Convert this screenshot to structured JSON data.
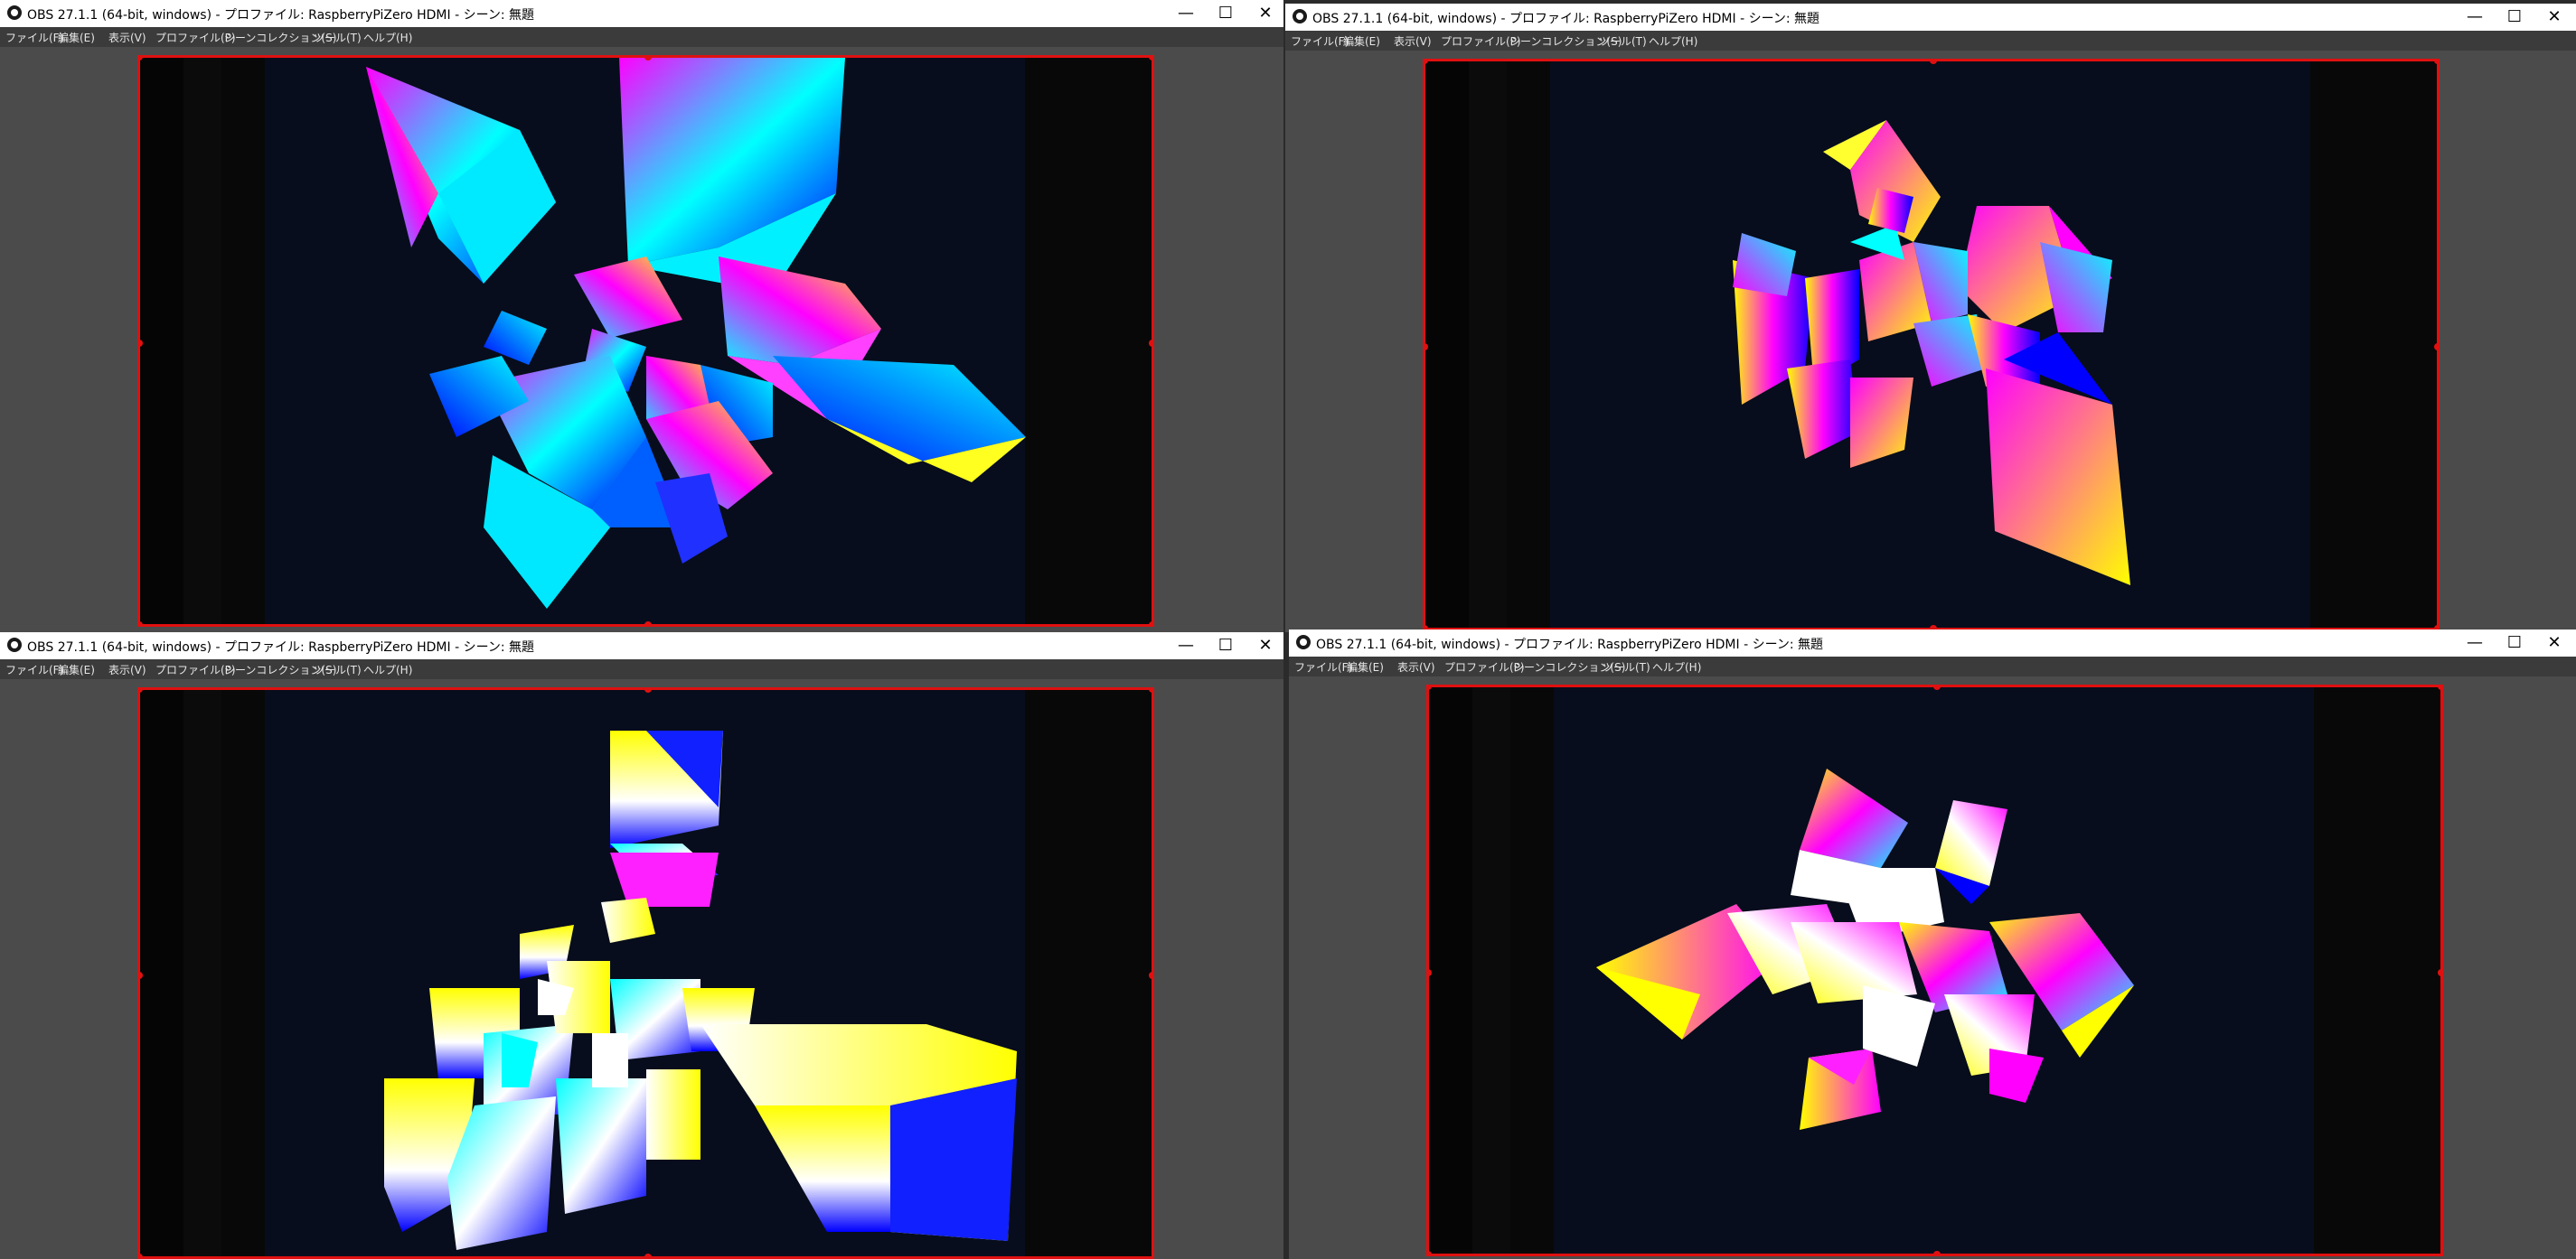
{
  "windows": [
    {
      "title": "OBS 27.1.1 (64-bit, windows) - プロファイル: RaspberryPiZero HDMI - シーン: 無題",
      "menu": [
        "ファイル(F)",
        "編集(E)",
        "表示(V)",
        "プロファイル(P)",
        "シーンコレクション(S)",
        "ツール(T)",
        "ヘルプ(H)"
      ],
      "controls": {
        "minimize": "—",
        "maximize": "☐",
        "close": "✕"
      }
    },
    {
      "title": "OBS 27.1.1 (64-bit, windows) - プロファイル: RaspberryPiZero HDMI - シーン: 無題",
      "menu": [
        "ファイル(F)",
        "編集(E)",
        "表示(V)",
        "プロファイル(P)",
        "シーンコレクション(S)",
        "ツール(T)",
        "ヘルプ(H)"
      ],
      "controls": {
        "minimize": "—",
        "maximize": "☐",
        "close": "✕"
      }
    },
    {
      "title": "OBS 27.1.1 (64-bit, windows) - プロファイル: RaspberryPiZero HDMI - シーン: 無題",
      "menu": [
        "ファイル(F)",
        "編集(E)",
        "表示(V)",
        "プロファイル(P)",
        "シーンコレクション(S)",
        "ツール(T)",
        "ヘルプ(H)"
      ],
      "controls": {
        "minimize": "—",
        "maximize": "☐",
        "close": "✕"
      }
    },
    {
      "title": "OBS 27.1.1 (64-bit, windows) - プロファイル: RaspberryPiZero HDMI - シーン: 無題",
      "menu": [
        "ファイル(F)",
        "編集(E)",
        "表示(V)",
        "プロファイル(P)",
        "シーンコレクション(S)",
        "ツール(T)",
        "ヘルプ(H)"
      ],
      "controls": {
        "minimize": "—",
        "maximize": "☐",
        "close": "✕"
      }
    }
  ],
  "colors": {
    "selection_border": "#e01010",
    "stage_background": "#070d1c",
    "shape_palette": [
      "#00ffff",
      "#ff00ff",
      "#ffff00",
      "#0000ff",
      "#ffffff"
    ]
  }
}
